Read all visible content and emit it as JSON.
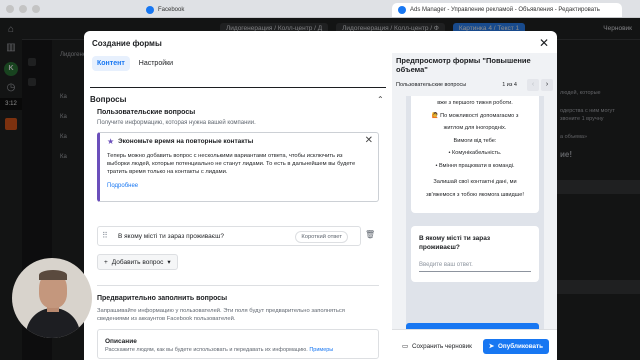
{
  "browser": {
    "tabs": [
      {
        "label": "Facebook",
        "active": false
      },
      {
        "label": "Ads Manager - Управление рекламой - Объявления - Редактировать",
        "active": true
      }
    ]
  },
  "rail": {
    "avatar_letter": "K",
    "time": "3:12"
  },
  "background": {
    "breadcrumbs": [
      "Лидогенерация / Колл-центр / Д",
      "Лидогенерация / Колл-центр / Ф",
      "Картинка 4 / Текст 1"
    ],
    "status": "Черновик",
    "left_list_header": "Лидогенерация",
    "left_items": [
      "Ка",
      "Ка",
      "Ка",
      "Ка"
    ],
    "right_texts": [
      "людей, которые",
      "одерства с ним могут",
      "звоните 1 вручну",
      "а объема»",
      "ие!"
    ]
  },
  "modal": {
    "title": "Создание формы",
    "tabs": [
      "Контент",
      "Настройки"
    ],
    "section_title": "Вопросы",
    "custom_questions": {
      "title": "Пользовательские вопросы",
      "desc": "Получите информацию, которая нужна вашей компании."
    },
    "info": {
      "title": "Экономьте время на повторные контакты",
      "text": "Теперь можно добавить вопрос с несколькими вариантами ответа, чтобы исключить из выборки людей, которые потенциально не станут лидами. То есть в дальнейшем вы будете тратить время только на контакты с лидами.",
      "link": "Подробнее"
    },
    "question": {
      "text": "В якому місті ти зараз проживаєш?",
      "type": "Короткий ответ"
    },
    "add_question": "Добавить вопрос",
    "prefill": {
      "title": "Предварительно заполнить вопросы",
      "desc": "Запрашивайте информацию у пользователей. Эти поля будут предварительно заполняться сведениями из аккаунтов Facebook пользователей."
    },
    "description": {
      "title": "Описание",
      "text": "Расскажите людям, как вы будете использовать и передавать их информацию.",
      "link": "Примеры"
    }
  },
  "preview": {
    "title": "Предпросмотр формы \"Повышение объема\"",
    "page_name": "Пользовательские вопросы",
    "counter": "1 из 4",
    "card_lines": [
      "вже з першого тижня роботи.",
      "🙋 По можливості допомагаємо з",
      "житлом для іногородніх.",
      "Вимоги від тебе:",
      "• Комунікабельність.",
      "• Вміння працювати в команді.",
      "",
      "Залишай свої контактні дані, ми",
      "зв'яжемося з тобою якомога швидше!"
    ],
    "question": "В якому місті ти зараз проживаєш?",
    "input_placeholder": "Введите ваш ответ.",
    "save_draft": "Сохранить черновик",
    "publish": "Опубликовать"
  },
  "colors": {
    "accent": "#1877f2",
    "info_border": "#6b4fbb"
  }
}
